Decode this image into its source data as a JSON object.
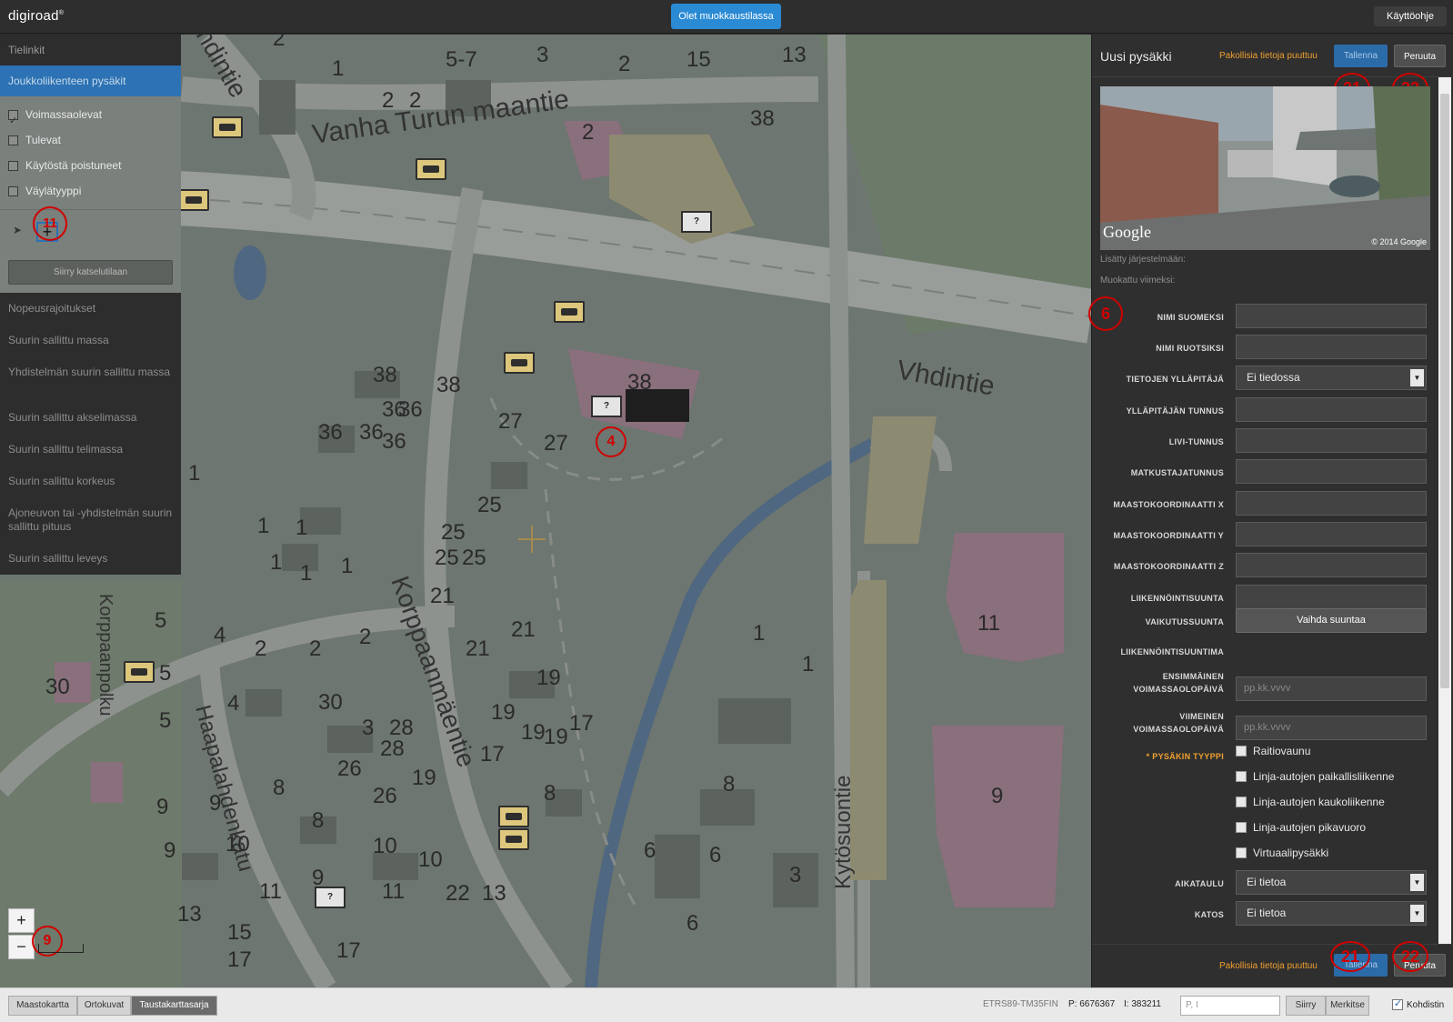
{
  "topbar": {
    "logo": "digiroad",
    "edit_mode": "Olet muokkaustilassa",
    "help": "Käyttöohje"
  },
  "left_panel": {
    "tab_links": "Tielinkit",
    "tab_stops": "Joukkoliikenteen pysäkit",
    "filters": [
      {
        "label": "Voimassaolevat",
        "checked": true
      },
      {
        "label": "Tulevat",
        "checked": false
      },
      {
        "label": "Käytöstä poistuneet",
        "checked": false
      },
      {
        "label": "Väylätyyppi",
        "checked": false
      }
    ],
    "tool_marker": "11",
    "view_button": "Siirry katselutilaan",
    "layers": [
      "Nopeusrajoitukset",
      "Suurin sallittu massa",
      "Yhdistelmän suurin sallittu massa",
      "Suurin sallittu akselimassa",
      "Suurin sallittu telimassa",
      "Suurin sallittu korkeus",
      "Ajoneuvon tai -yhdistelmän suurin sallittu pituus",
      "Suurin sallittu leveys"
    ]
  },
  "map": {
    "street_names": [
      "Vanha Turun maantie",
      "Vhdintie",
      "Korppaanmäentie",
      "Haapalahdenkatu",
      "Kytösuontie",
      "Korppaanpolku",
      "ndintie"
    ],
    "house_numbers": [
      "2",
      "1",
      "5-7",
      "3",
      "2",
      "15",
      "13",
      "2",
      "2",
      "2",
      "38",
      "38",
      "38",
      "38",
      "36",
      "36",
      "36",
      "36",
      "36",
      "27",
      "27",
      "25",
      "25",
      "25",
      "25",
      "21",
      "21",
      "21",
      "1",
      "1",
      "1",
      "1",
      "1",
      "1",
      "5",
      "5",
      "5",
      "4",
      "4",
      "2",
      "2",
      "2",
      "30",
      "30",
      "3",
      "28",
      "28",
      "26",
      "26",
      "19",
      "19",
      "19",
      "19",
      "19",
      "17",
      "17",
      "8",
      "8",
      "8",
      "9",
      "9",
      "9",
      "9",
      "10",
      "10",
      "10",
      "11",
      "11",
      "13",
      "15",
      "17",
      "17",
      "22",
      "13",
      "6",
      "6",
      "6",
      "3",
      "8",
      "1",
      "11",
      "9",
      "1"
    ],
    "markers": {
      "stop": "4",
      "zoom": "9"
    },
    "zoom_in": "+",
    "zoom_out": "−"
  },
  "right_panel": {
    "title": "Uusi pysäkki",
    "warning": "Pakollisia tietoja puuttuu",
    "save": "Tallenna",
    "cancel": "Peruuta",
    "markers": {
      "save": "21",
      "cancel": "22",
      "fields": "6"
    },
    "photo_credit_left": "Google",
    "photo_credit_right": "© 2014 Google",
    "added_label": "Lisätty järjestelmään:",
    "modified_label": "Muokattu viimeksi:",
    "fields": [
      {
        "label": "NIMI SUOMEKSI",
        "value": ""
      },
      {
        "label": "NIMI RUOTSIKSI",
        "value": ""
      },
      {
        "label": "TIETOJEN YLLÄPITÄJÄ",
        "value": "Ei tiedossa"
      },
      {
        "label": "YLLÄPITÄJÄN TUNNUS",
        "value": ""
      },
      {
        "label": "LIVI-TUNNUS",
        "value": ""
      },
      {
        "label": "MATKUSTAJATUNNUS",
        "value": ""
      },
      {
        "label": "MAASTOKOORDINAATTI X",
        "value": ""
      },
      {
        "label": "MAASTOKOORDINAATTI Y",
        "value": ""
      },
      {
        "label": "MAASTOKOORDINAATTI Z",
        "value": ""
      },
      {
        "label": "LIIKENNÖINTISUUNTA",
        "value": ""
      }
    ],
    "direction_label": "VAIKUTUSSUUNTA",
    "direction_button": "Vaihda suuntaa",
    "heading_label": "LIIKENNÖINTISUUNTIMA",
    "first_valid_label_1": "ENSIMMÄINEN",
    "first_valid_label_2": "VOIMASSAOLOPÄIVÄ",
    "last_valid_label_1": "VIIMEINEN",
    "last_valid_label_2": "VOIMASSAOLOPÄIVÄ",
    "date_placeholder": "pp.kk.vvvv",
    "type_label": "* PYSÄKIN TYYPPI",
    "types": [
      "Raitiovaunu",
      "Linja-autojen paikallisliikenne",
      "Linja-autojen kaukoliikenne",
      "Linja-autojen pikavuoro",
      "Virtuaalipysäkki"
    ],
    "timetable_label": "AIKATAULU",
    "timetable_value": "Ei tietoa",
    "shelter_label": "KATOS",
    "shelter_value": "Ei tietoa"
  },
  "bottombar": {
    "base_layers": [
      "Maastokartta",
      "Ortokuvat",
      "Taustakarttasarja"
    ],
    "selected_layer": "Taustakarttasarja",
    "coord_system": "ETRS89-TM35FIN",
    "p_label": "P: 6676367",
    "i_label": "I: 383211",
    "coord_placeholder": "P, I",
    "move": "Siirry",
    "mark": "Merkitse",
    "crosshair": "Kohdistin"
  },
  "colors": {
    "accent": "#2a8ad4",
    "warning": "#f0a030",
    "annotation": "#d10000",
    "map_bg": "#6d7670"
  }
}
